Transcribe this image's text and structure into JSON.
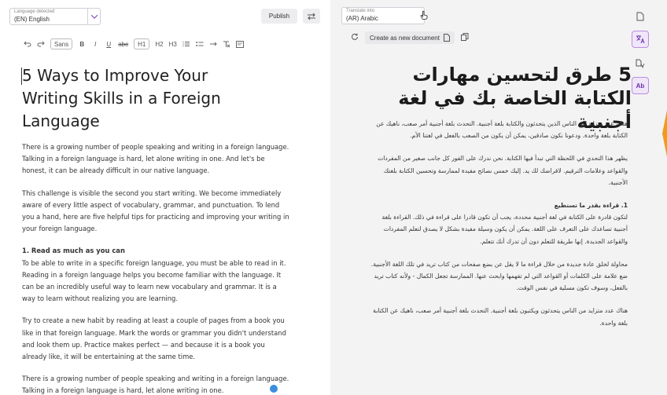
{
  "source": {
    "language_label": "Language detected",
    "language_value": "(EN) English",
    "publish_label": "Publish",
    "toolbar": {
      "undo_icon": "undo-icon",
      "redo_icon": "redo-icon",
      "font": "Sans",
      "bold": "B",
      "italic": "I",
      "underline": "U",
      "strike": "abc",
      "h1": "H1",
      "h2": "H2",
      "h3": "H3"
    },
    "title": "5 Ways to Improve Your Writing Skills in a Foreign Language",
    "paragraphs": [
      "There is a growing number of people speaking and writing in a foreign language. Talking in a foreign language is hard, let alone writing in one. And let's be honest, it can be already difficult in our native language.",
      "This challenge is visible the second you start writing. We become immediately aware of every little aspect of vocabulary, grammar, and punctuation. To lend you a hand, here are five helpful tips for practicing and improving your writing in your foreign language."
    ],
    "section_heading": "1. Read as much as you can",
    "section_paragraphs": [
      "To be able to write in a specific foreign language, you must be able to read in it. Reading in a foreign language helps you become familiar with the language. It can be an incredibly useful way to learn new vocabulary and grammar. It is a way to learn without realizing you are learning.",
      "Try to create a new habit by reading at least a couple of pages from a book you like in that foreign language. Mark the words or grammar you didn't understand and look them up. Practice makes perfect — and because it is a book you already like, it will be entertaining at the same time.",
      "There is a growing number of people speaking and writing in a foreign language. Talking in a foreign language is hard, let alone writing in one."
    ]
  },
  "target": {
    "language_label": "Translate into",
    "language_value": "(AR) Arabic",
    "create_label": "Create as new document",
    "title": "5 طرق لتحسين مهارات الكتابة الخاصة بك في لغة أجنبية",
    "paragraphs": [
      "هناك عدد متزايد من الناس الذين يتحدثون والكتابة بلغة أجنبية. التحدث بلغة أجنبية أمر صعب، ناهيك عن الكتابة بلغة واحدة. ودعونا نكون صادقين، يمكن أن يكون من الصعب بالفعل في لغتنا الأم.",
      "يظهر هذا التحدي في اللحظة التي تبدأ فيها الكتابة. نحن ندرك على الفور كل جانب صغير من المفردات والقواعد وعلامات الترقيم. لاقراضك لك يد. إليك خمس نصائح مفيدة لممارسة وتحسين الكتابة بلغتك الأجنبية."
    ],
    "section_heading": "1. قراءة بقدر ما تستطيع",
    "section_paragraphs": [
      "لتكون قادرة على الكتابة في لغة أجنبية محددة، يجب أن تكون قادرا على قراءة في ذلك. القراءة بلغة أجنبية تساعدك على التعرف على اللغة. يمكن أن يكون وسيلة مفيدة بشكل لا يصدق لتعلم المفردات والقواعد الجديدة. إنها طريقة للتعلم دون أن تدرك أنك تتعلم.",
      "محاولة لخلق عادة جديدة من خلال قراءة ما لا يقل عن بضع صفحات من كتاب تريد في تلك اللغة الأجنبية. ضع علامة على الكلمات أو القواعد التي لم تفهمها وابحث عنها. الممارسة تجعل الكمال - ولأنه كتاب تريد بالفعل، وسوف تكون مسلية في نفس الوقت.",
      "هناك عدد متزايد من الناس يتحدثون ويكتبون بلغة أجنبية. التحدث بلغة أجنبية أمر صعب، ناهيك عن الكتابة بلغة واحدة."
    ]
  },
  "colors": {
    "accent": "#7b3fb6",
    "right_panel_bg": "#f3f3f4",
    "edge_orange": "#f29a1a"
  }
}
